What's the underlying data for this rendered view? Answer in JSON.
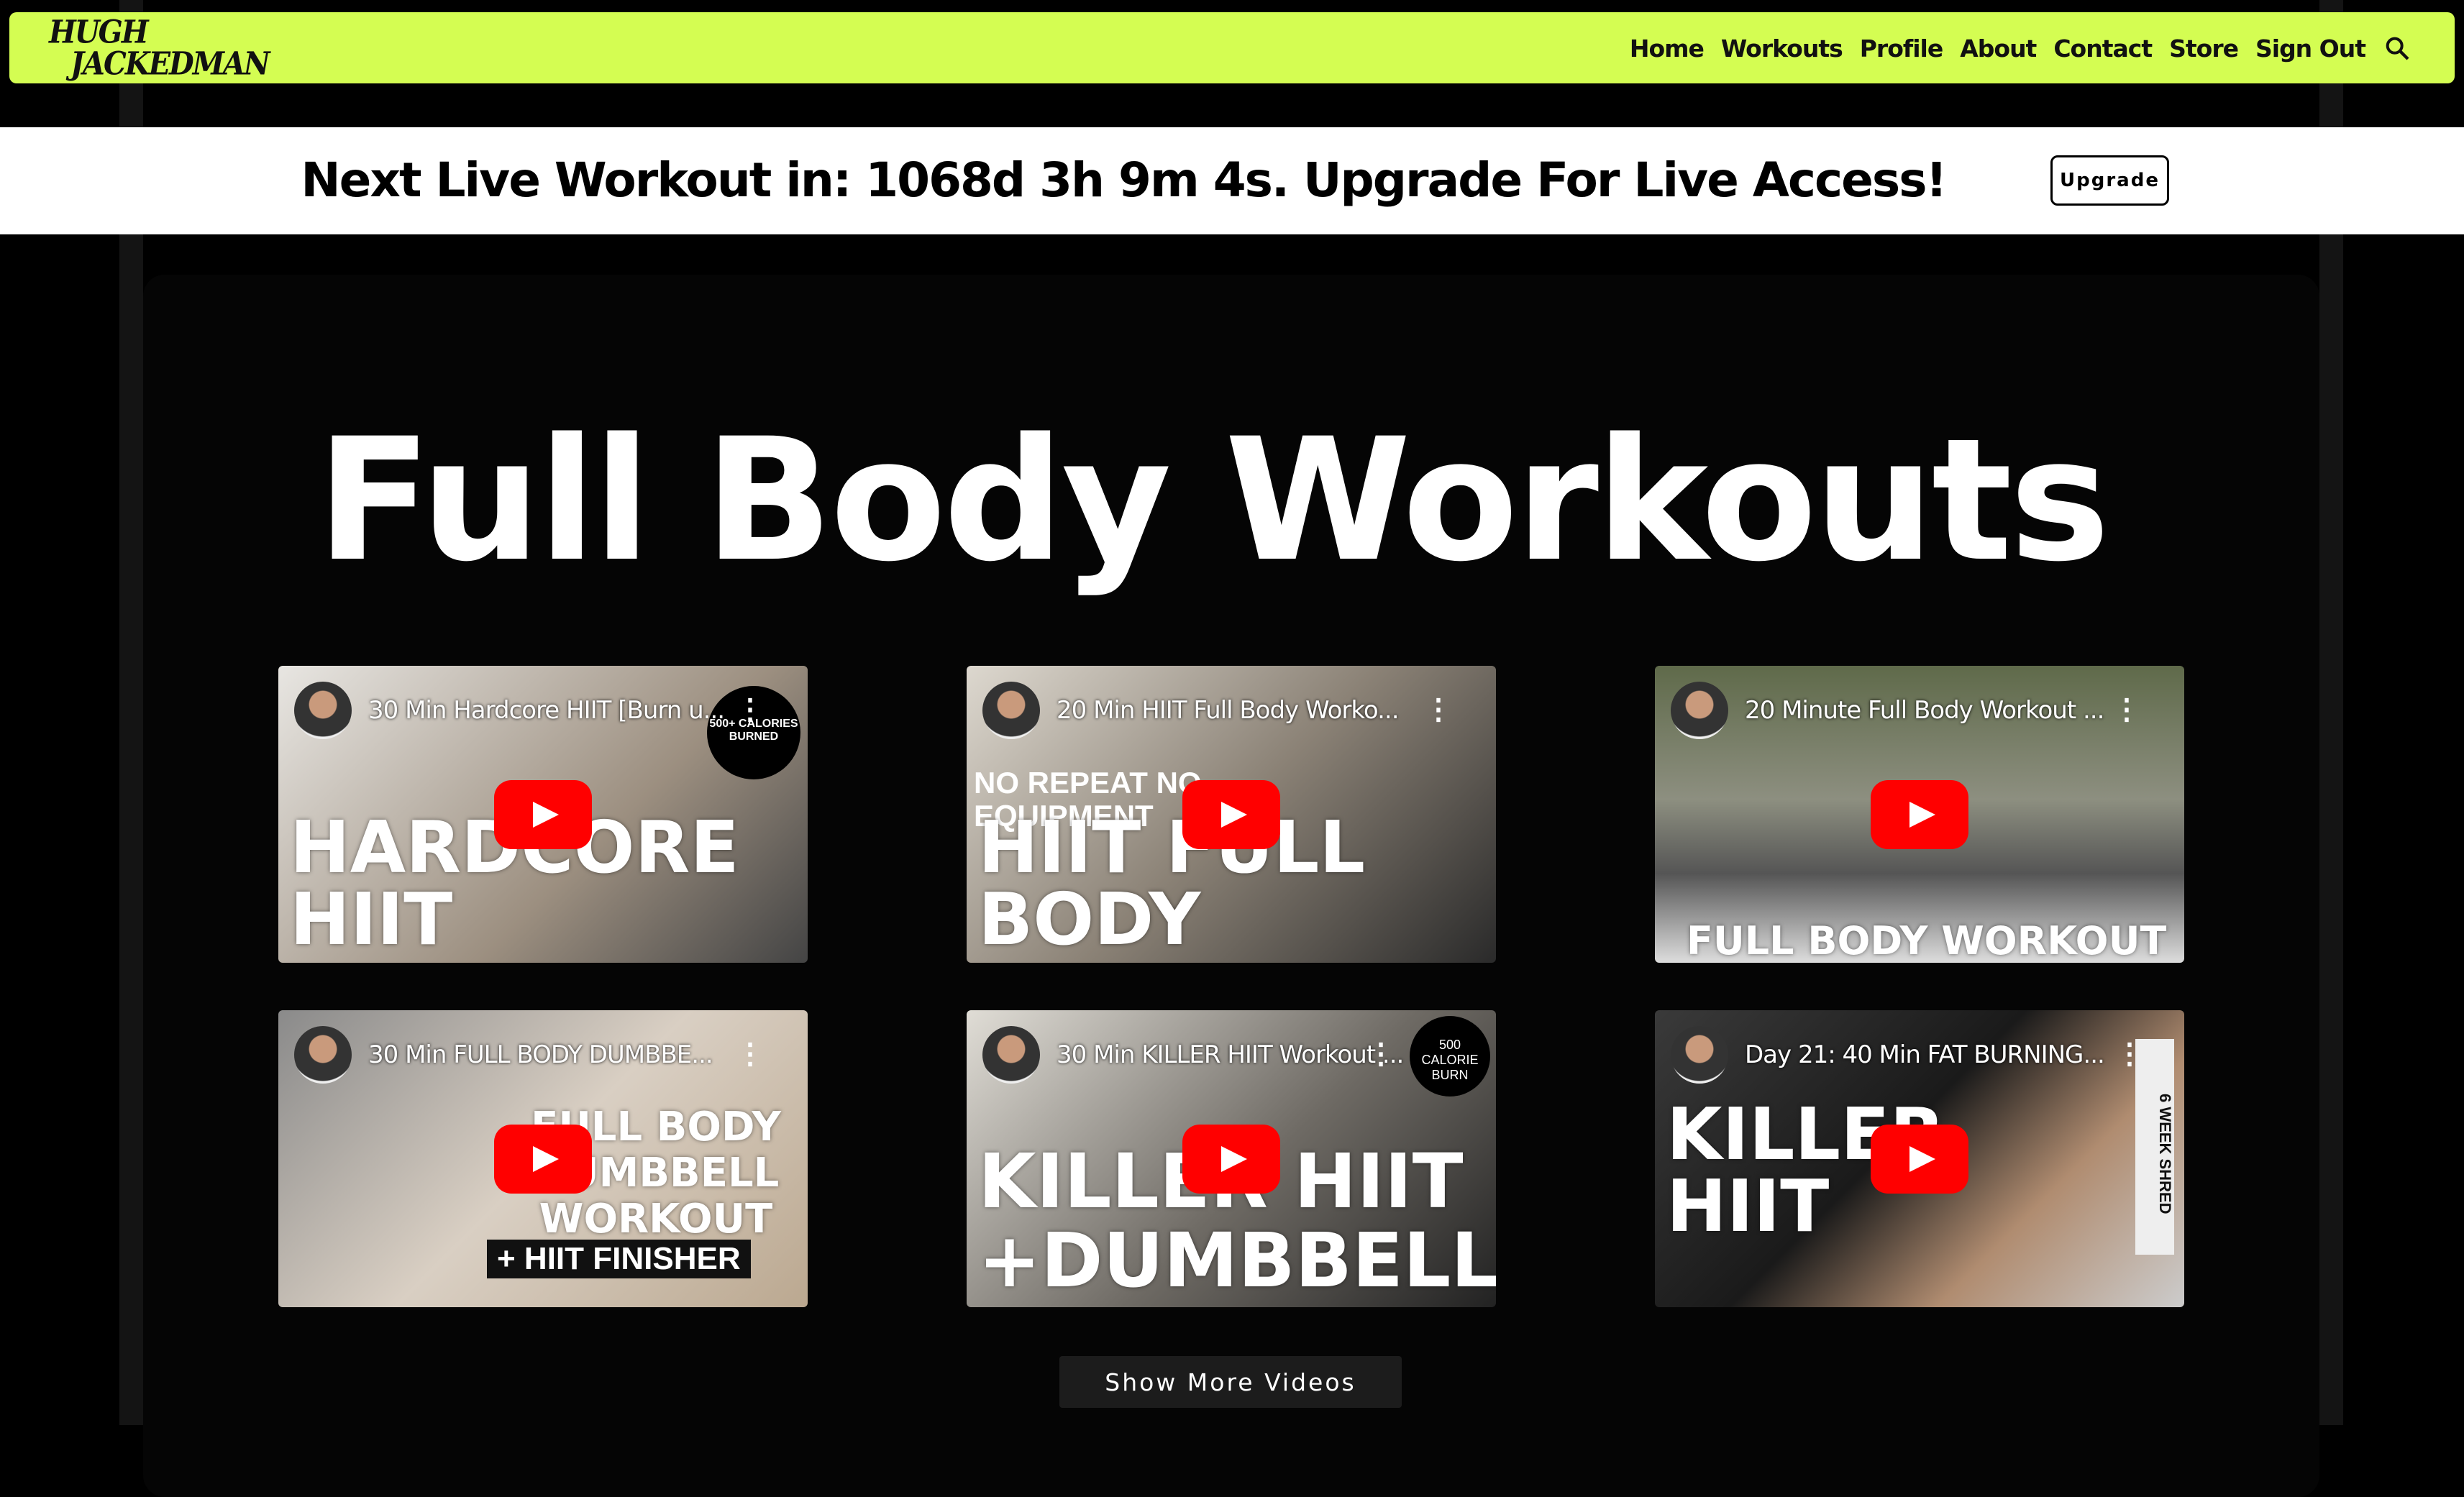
{
  "logo": {
    "line1": "HUGH",
    "line2": "JACKEDMAN"
  },
  "nav": [
    "Home",
    "Workouts",
    "Profile",
    "About",
    "Contact",
    "Store",
    "Sign Out"
  ],
  "banner": {
    "text": "Next Live Workout in: 1068d 3h 9m 4s. Upgrade For Live Access!",
    "button": "Upgrade"
  },
  "page_title": "Full Body Workouts",
  "videos": [
    {
      "title": "30 Min Hardcore HIIT [Burn u...",
      "overlay": "HARDCORE HIIT",
      "badge": "500+ CALORIES BURNED"
    },
    {
      "title": "20 Min HIIT Full Body Worko...",
      "overlay": "HIIT FULL BODY",
      "badge": "NO REPEAT NO EQUIPMENT"
    },
    {
      "title": "20 Minute Full Body Workout ...",
      "overlay": "FULL BODY WORKOUT",
      "badge": ""
    },
    {
      "title": "30 Min FULL BODY DUMBBE...",
      "overlay": "FULL BODY DUMBBELL WORKOUT",
      "badge": "+ HIIT FINISHER"
    },
    {
      "title": "30 Min KILLER HIIT Workout ...",
      "overlay": "KILLER HIIT +DUMBBELLS",
      "badge": "500 CALORIE BURN"
    },
    {
      "title": "Day 21: 40 Min FAT BURNING...",
      "overlay": "KILLER HIIT",
      "badge": "6 WEEK SHRED"
    }
  ],
  "show_more": "Show More Videos"
}
